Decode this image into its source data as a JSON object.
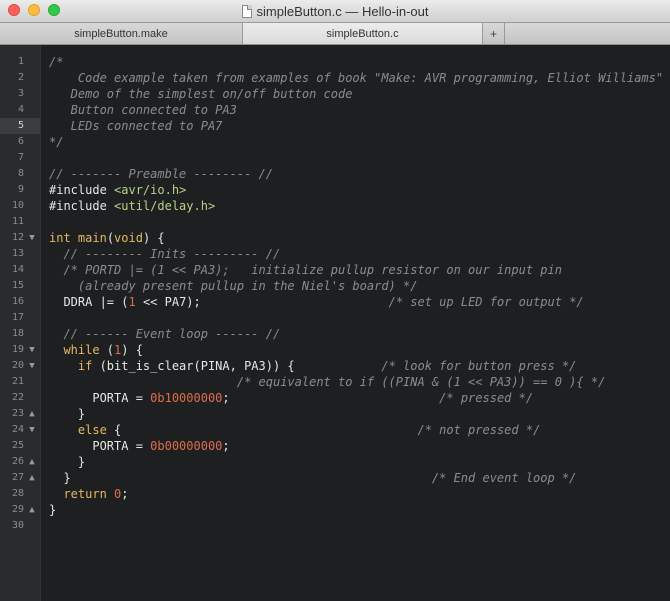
{
  "window": {
    "title": "simpleButton.c — Hello-in-out",
    "tabs": [
      {
        "label": "simpleButton.make",
        "active": false
      },
      {
        "label": "simpleButton.c",
        "active": true
      }
    ],
    "add_tab_glyph": "+"
  },
  "editor": {
    "current_line": 5,
    "gutter": [
      {
        "n": "1",
        "fold": ""
      },
      {
        "n": "2",
        "fold": ""
      },
      {
        "n": "3",
        "fold": ""
      },
      {
        "n": "4",
        "fold": ""
      },
      {
        "n": "5",
        "fold": ""
      },
      {
        "n": "6",
        "fold": ""
      },
      {
        "n": "7",
        "fold": ""
      },
      {
        "n": "8",
        "fold": ""
      },
      {
        "n": "9",
        "fold": ""
      },
      {
        "n": "10",
        "fold": ""
      },
      {
        "n": "11",
        "fold": ""
      },
      {
        "n": "12",
        "fold": "▼"
      },
      {
        "n": "13",
        "fold": ""
      },
      {
        "n": "14",
        "fold": ""
      },
      {
        "n": "15",
        "fold": ""
      },
      {
        "n": "16",
        "fold": ""
      },
      {
        "n": "17",
        "fold": ""
      },
      {
        "n": "18",
        "fold": ""
      },
      {
        "n": "19",
        "fold": "▼"
      },
      {
        "n": "20",
        "fold": "▼"
      },
      {
        "n": "21",
        "fold": ""
      },
      {
        "n": "22",
        "fold": ""
      },
      {
        "n": "23",
        "fold": "▲"
      },
      {
        "n": "24",
        "fold": "▼"
      },
      {
        "n": "25",
        "fold": ""
      },
      {
        "n": "26",
        "fold": "▲"
      },
      {
        "n": "27",
        "fold": "▲"
      },
      {
        "n": "28",
        "fold": ""
      },
      {
        "n": "29",
        "fold": "▲"
      },
      {
        "n": "30",
        "fold": ""
      }
    ],
    "lines": [
      [
        [
          "c",
          "/*"
        ]
      ],
      [
        [
          "c",
          "    Code example taken from examples of book \"Make: AVR programming, Elliot Williams\""
        ]
      ],
      [
        [
          "c",
          "   Demo of the simplest on/off button code"
        ]
      ],
      [
        [
          "c",
          "   Button connected to PA3"
        ]
      ],
      [
        [
          "c",
          "   LEDs connected to PA7"
        ]
      ],
      [
        [
          "c",
          "*/"
        ]
      ],
      [
        [
          "p",
          ""
        ]
      ],
      [
        [
          "c",
          "// ------- Preamble -------- //"
        ]
      ],
      [
        [
          "pre",
          "#include "
        ],
        [
          "inc",
          "<avr/io.h>"
        ]
      ],
      [
        [
          "pre",
          "#include "
        ],
        [
          "inc",
          "<util/delay.h>"
        ]
      ],
      [
        [
          "p",
          ""
        ]
      ],
      [
        [
          "t",
          "int "
        ],
        [
          "f",
          "main"
        ],
        [
          "p",
          "("
        ],
        [
          "t",
          "void"
        ],
        [
          "p",
          ") {"
        ]
      ],
      [
        [
          "p",
          "  "
        ],
        [
          "c",
          "// -------- Inits --------- //"
        ]
      ],
      [
        [
          "p",
          "  "
        ],
        [
          "c",
          "/* PORTD |= (1 << PA3);   initialize pullup resistor on our input pin"
        ]
      ],
      [
        [
          "c",
          "    (already present pullup in the Niel's board) */"
        ]
      ],
      [
        [
          "p",
          "  DDRA |= ("
        ],
        [
          "n",
          "1"
        ],
        [
          "p",
          " << PA7);                          "
        ],
        [
          "c",
          "/* set up LED for output */"
        ]
      ],
      [
        [
          "p",
          ""
        ]
      ],
      [
        [
          "p",
          "  "
        ],
        [
          "c",
          "// ------ Event loop ------ //"
        ]
      ],
      [
        [
          "p",
          "  "
        ],
        [
          "k",
          "while"
        ],
        [
          "p",
          " ("
        ],
        [
          "n",
          "1"
        ],
        [
          "p",
          ") {"
        ]
      ],
      [
        [
          "p",
          "    "
        ],
        [
          "k",
          "if"
        ],
        [
          "p",
          " (bit_is_clear(PINA, PA3)) {            "
        ],
        [
          "c",
          "/* look for button press */"
        ]
      ],
      [
        [
          "p",
          "                          "
        ],
        [
          "c",
          "/* equivalent to if ((PINA & (1 << PA3)) == 0 ){ */"
        ]
      ],
      [
        [
          "p",
          "      PORTA = "
        ],
        [
          "n",
          "0b10000000"
        ],
        [
          "p",
          ";                             "
        ],
        [
          "c",
          "/* pressed */"
        ]
      ],
      [
        [
          "p",
          "    }"
        ]
      ],
      [
        [
          "p",
          "    "
        ],
        [
          "k",
          "else"
        ],
        [
          "p",
          " {                                         "
        ],
        [
          "c",
          "/* not pressed */"
        ]
      ],
      [
        [
          "p",
          "      PORTA = "
        ],
        [
          "n",
          "0b00000000"
        ],
        [
          "p",
          ";"
        ]
      ],
      [
        [
          "p",
          "    }"
        ]
      ],
      [
        [
          "p",
          "  }                                                  "
        ],
        [
          "c",
          "/* End event loop */"
        ]
      ],
      [
        [
          "p",
          "  "
        ],
        [
          "k",
          "return"
        ],
        [
          "p",
          " "
        ],
        [
          "n",
          "0"
        ],
        [
          "p",
          ";"
        ]
      ],
      [
        [
          "p",
          "}"
        ]
      ],
      [
        [
          "p",
          ""
        ]
      ]
    ]
  }
}
